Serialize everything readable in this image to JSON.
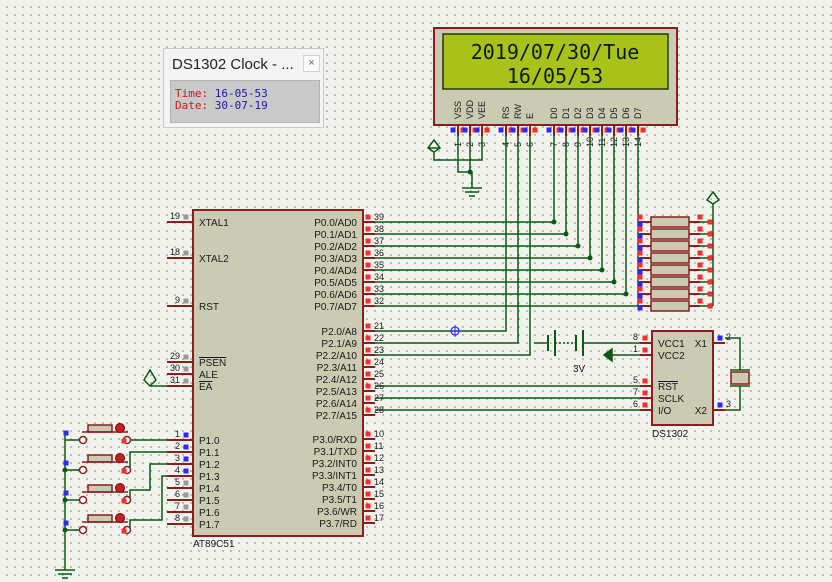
{
  "popup": {
    "title": "DS1302 Clock - ...",
    "close_glyph": "×",
    "time_label": "Time:",
    "time_value": "16-05-53",
    "date_label": "Date:",
    "date_value": "30-07-19"
  },
  "lcd": {
    "line1": "2019/07/30/Tue",
    "line2": "16/05/53",
    "pin_labels": [
      "VSS",
      "VDD",
      "VEE",
      "RS",
      "RW",
      "E",
      "D0",
      "D1",
      "D2",
      "D3",
      "D4",
      "D5",
      "D6",
      "D7"
    ],
    "pin_numbers": [
      "1",
      "2",
      "3",
      "4",
      "5",
      "6",
      "7",
      "8",
      "9",
      "10",
      "11",
      "12",
      "13",
      "14"
    ]
  },
  "mcu": {
    "name": "AT89C51",
    "left_pins": [
      {
        "num": "19",
        "label": "XTAL1"
      },
      {
        "num": "18",
        "label": "XTAL2"
      },
      {
        "num": "9",
        "label": "RST"
      },
      {
        "num": "29",
        "label": "PSEN"
      },
      {
        "num": "30",
        "label": "ALE"
      },
      {
        "num": "31",
        "label": "EA"
      },
      {
        "num": "1",
        "label": "P1.0"
      },
      {
        "num": "2",
        "label": "P1.1"
      },
      {
        "num": "3",
        "label": "P1.2"
      },
      {
        "num": "4",
        "label": "P1.3"
      },
      {
        "num": "5",
        "label": "P1.4"
      },
      {
        "num": "6",
        "label": "P1.5"
      },
      {
        "num": "7",
        "label": "P1.6"
      },
      {
        "num": "8",
        "label": "P1.7"
      }
    ],
    "right_pins": [
      {
        "num": "39",
        "label": "P0.0/AD0"
      },
      {
        "num": "38",
        "label": "P0.1/AD1"
      },
      {
        "num": "37",
        "label": "P0.2/AD2"
      },
      {
        "num": "36",
        "label": "P0.3/AD3"
      },
      {
        "num": "35",
        "label": "P0.4/AD4"
      },
      {
        "num": "34",
        "label": "P0.5/AD5"
      },
      {
        "num": "33",
        "label": "P0.6/AD6"
      },
      {
        "num": "32",
        "label": "P0.7/AD7"
      },
      {
        "num": "21",
        "label": "P2.0/A8"
      },
      {
        "num": "22",
        "label": "P2.1/A9"
      },
      {
        "num": "23",
        "label": "P2.2/A10"
      },
      {
        "num": "24",
        "label": "P2.3/A11"
      },
      {
        "num": "25",
        "label": "P2.4/A12"
      },
      {
        "num": "26",
        "label": "P2.5/A13"
      },
      {
        "num": "27",
        "label": "P2.6/A14"
      },
      {
        "num": "28",
        "label": "P2.7/A15"
      },
      {
        "num": "10",
        "label": "P3.0/RXD"
      },
      {
        "num": "11",
        "label": "P3.1/TXD"
      },
      {
        "num": "12",
        "label": "P3.2/INT0"
      },
      {
        "num": "13",
        "label": "P3.3/INT1"
      },
      {
        "num": "14",
        "label": "P3.4/T0"
      },
      {
        "num": "15",
        "label": "P3.5/T1"
      },
      {
        "num": "16",
        "label": "P3.6/WR"
      },
      {
        "num": "17",
        "label": "P3.7/RD"
      }
    ]
  },
  "rtc": {
    "name": "DS1302",
    "pins": [
      {
        "num": "8",
        "label": "VCC1"
      },
      {
        "num": "1",
        "label": "VCC2"
      },
      {
        "num": "5",
        "label": "RST"
      },
      {
        "num": "7",
        "label": "SCLK"
      },
      {
        "num": "6",
        "label": "I/O"
      },
      {
        "num": "2",
        "label": "X1"
      },
      {
        "num": "3",
        "label": "X2"
      }
    ]
  },
  "battery": {
    "label": "3V"
  },
  "colors": {
    "wire": "#0b5a14",
    "outline": "#8b1d1d",
    "chip_fill": "#cbcbb3",
    "lcd_screen": "#a8c21a",
    "pin_red": "#ff2a2a",
    "pin_blue": "#2a2aff",
    "label_blue": "#1a1aa0",
    "label_red": "#d01818"
  }
}
